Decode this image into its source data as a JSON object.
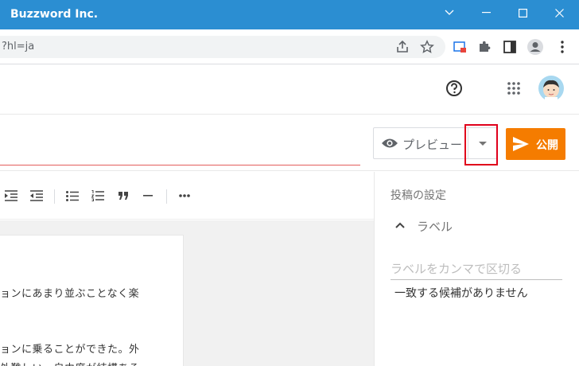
{
  "window": {
    "title": "Buzzword Inc."
  },
  "browser": {
    "url_fragment": "?hl=ja"
  },
  "editor": {
    "preview_label": "プレビュー",
    "publish_label": "公開",
    "body_lines": [
      "ョンにあまり並ぶことなく楽",
      "ョンに乗ることができた。外",
      "外難しい。自由度が結構ある"
    ]
  },
  "side_panel": {
    "heading": "投稿の設定",
    "labels_title": "ラベル",
    "labels_placeholder": "ラベルをカンマで区切る",
    "no_match_text": "一致する候補がありません"
  },
  "colors": {
    "titlebar": "#2b8ed2",
    "publish": "#f57c00",
    "highlight": "#e0001b",
    "title_underline": "#e35d5b"
  }
}
